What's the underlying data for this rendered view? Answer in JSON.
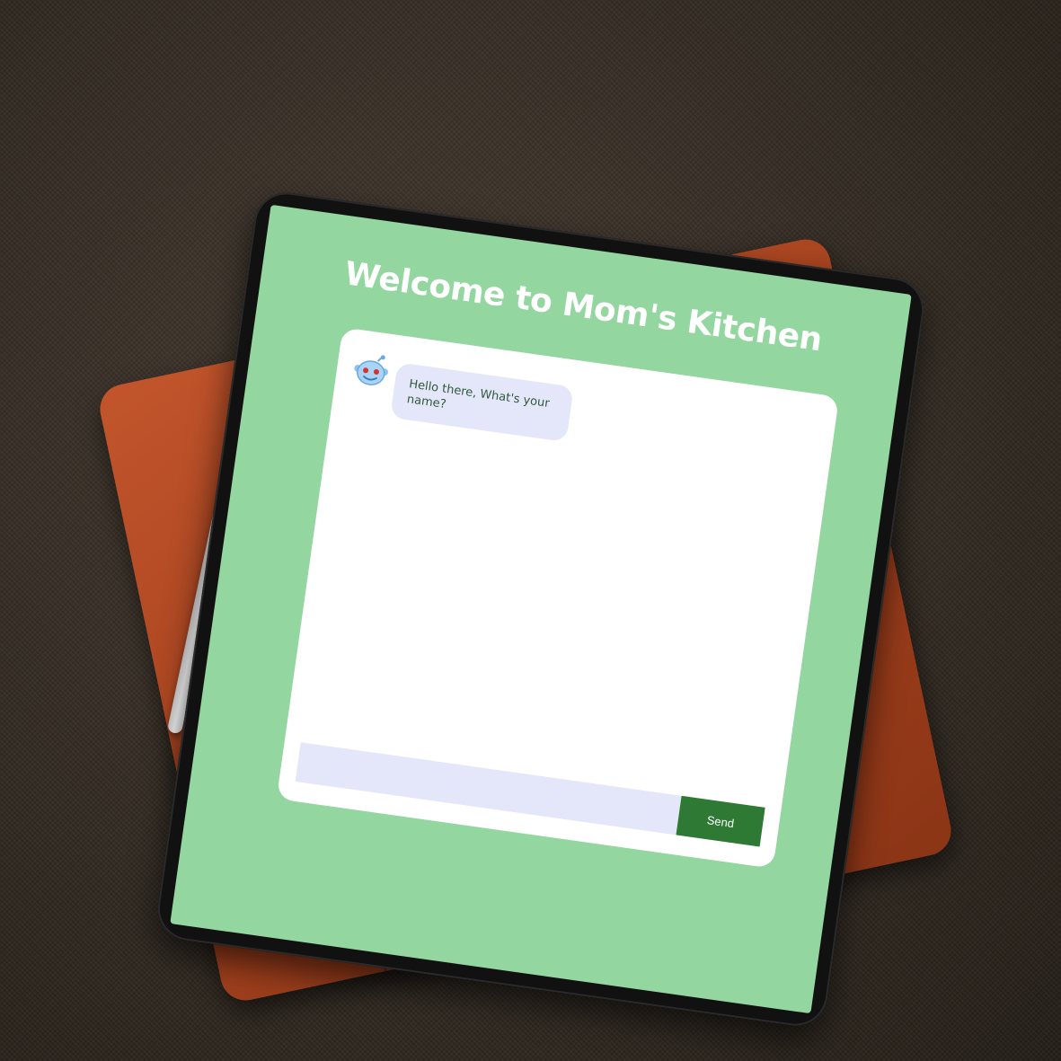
{
  "app": {
    "title": "Welcome to Mom's Kitchen"
  },
  "chat": {
    "messages": [
      {
        "sender": "bot",
        "avatar_icon": "robot-icon",
        "text": "Hello there, What's your name?"
      }
    ],
    "input": {
      "value": "",
      "placeholder": ""
    },
    "send_label": "Send"
  },
  "colors": {
    "screen_background": "#93d6a0",
    "card_background": "#ffffff",
    "bubble_background": "#e4e6f9",
    "input_background": "#e4e6f9",
    "send_button": "#2e7a34",
    "bubble_text": "#2f5a3a"
  }
}
